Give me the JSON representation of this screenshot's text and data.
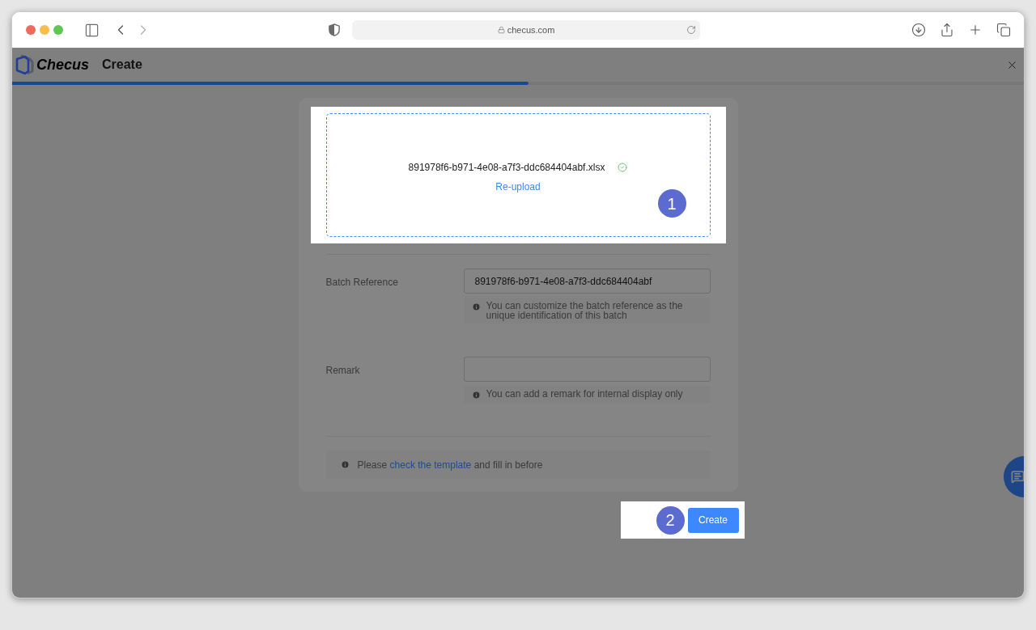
{
  "browser": {
    "url": "checus.com"
  },
  "app": {
    "brand": "Checus",
    "title": "Create",
    "progress": {
      "level": 0.51
    }
  },
  "upload": {
    "file_name": "891978f6-b971-4e08-a7f3-ddc684404abf.xlsx",
    "uploaded": true,
    "reupload_label": "Re-upload",
    "step_badge": "1"
  },
  "fields": [
    {
      "label": "Batch Reference",
      "value": "891978f6-b971-4e08-a7f3-ddc684404abf",
      "hint": "You can customize the batch reference as the unique identification of this batch"
    },
    {
      "label": "Remark",
      "hint": "You can add a remark for internal display only"
    }
  ],
  "note": {
    "before": "Please",
    "link": "check the template",
    "after": "and fill in before"
  },
  "actions": {
    "step_badge": "2",
    "create_label": "Create"
  }
}
